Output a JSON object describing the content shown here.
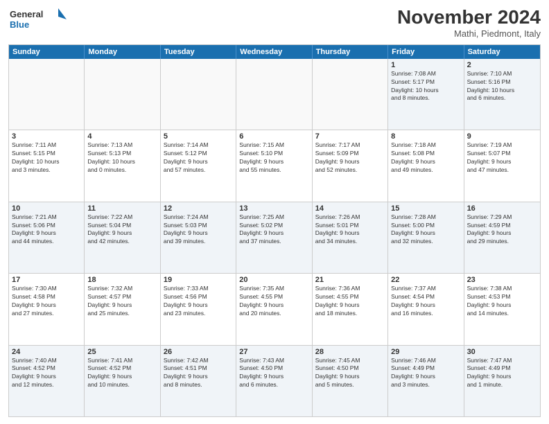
{
  "logo": {
    "line1": "General",
    "line2": "Blue"
  },
  "title": "November 2024",
  "subtitle": "Mathi, Piedmont, Italy",
  "days": [
    "Sunday",
    "Monday",
    "Tuesday",
    "Wednesday",
    "Thursday",
    "Friday",
    "Saturday"
  ],
  "weeks": [
    [
      {
        "day": "",
        "info": ""
      },
      {
        "day": "",
        "info": ""
      },
      {
        "day": "",
        "info": ""
      },
      {
        "day": "",
        "info": ""
      },
      {
        "day": "",
        "info": ""
      },
      {
        "day": "1",
        "info": "Sunrise: 7:08 AM\nSunset: 5:17 PM\nDaylight: 10 hours\nand 8 minutes."
      },
      {
        "day": "2",
        "info": "Sunrise: 7:10 AM\nSunset: 5:16 PM\nDaylight: 10 hours\nand 6 minutes."
      }
    ],
    [
      {
        "day": "3",
        "info": "Sunrise: 7:11 AM\nSunset: 5:15 PM\nDaylight: 10 hours\nand 3 minutes."
      },
      {
        "day": "4",
        "info": "Sunrise: 7:13 AM\nSunset: 5:13 PM\nDaylight: 10 hours\nand 0 minutes."
      },
      {
        "day": "5",
        "info": "Sunrise: 7:14 AM\nSunset: 5:12 PM\nDaylight: 9 hours\nand 57 minutes."
      },
      {
        "day": "6",
        "info": "Sunrise: 7:15 AM\nSunset: 5:10 PM\nDaylight: 9 hours\nand 55 minutes."
      },
      {
        "day": "7",
        "info": "Sunrise: 7:17 AM\nSunset: 5:09 PM\nDaylight: 9 hours\nand 52 minutes."
      },
      {
        "day": "8",
        "info": "Sunrise: 7:18 AM\nSunset: 5:08 PM\nDaylight: 9 hours\nand 49 minutes."
      },
      {
        "day": "9",
        "info": "Sunrise: 7:19 AM\nSunset: 5:07 PM\nDaylight: 9 hours\nand 47 minutes."
      }
    ],
    [
      {
        "day": "10",
        "info": "Sunrise: 7:21 AM\nSunset: 5:06 PM\nDaylight: 9 hours\nand 44 minutes."
      },
      {
        "day": "11",
        "info": "Sunrise: 7:22 AM\nSunset: 5:04 PM\nDaylight: 9 hours\nand 42 minutes."
      },
      {
        "day": "12",
        "info": "Sunrise: 7:24 AM\nSunset: 5:03 PM\nDaylight: 9 hours\nand 39 minutes."
      },
      {
        "day": "13",
        "info": "Sunrise: 7:25 AM\nSunset: 5:02 PM\nDaylight: 9 hours\nand 37 minutes."
      },
      {
        "day": "14",
        "info": "Sunrise: 7:26 AM\nSunset: 5:01 PM\nDaylight: 9 hours\nand 34 minutes."
      },
      {
        "day": "15",
        "info": "Sunrise: 7:28 AM\nSunset: 5:00 PM\nDaylight: 9 hours\nand 32 minutes."
      },
      {
        "day": "16",
        "info": "Sunrise: 7:29 AM\nSunset: 4:59 PM\nDaylight: 9 hours\nand 29 minutes."
      }
    ],
    [
      {
        "day": "17",
        "info": "Sunrise: 7:30 AM\nSunset: 4:58 PM\nDaylight: 9 hours\nand 27 minutes."
      },
      {
        "day": "18",
        "info": "Sunrise: 7:32 AM\nSunset: 4:57 PM\nDaylight: 9 hours\nand 25 minutes."
      },
      {
        "day": "19",
        "info": "Sunrise: 7:33 AM\nSunset: 4:56 PM\nDaylight: 9 hours\nand 23 minutes."
      },
      {
        "day": "20",
        "info": "Sunrise: 7:35 AM\nSunset: 4:55 PM\nDaylight: 9 hours\nand 20 minutes."
      },
      {
        "day": "21",
        "info": "Sunrise: 7:36 AM\nSunset: 4:55 PM\nDaylight: 9 hours\nand 18 minutes."
      },
      {
        "day": "22",
        "info": "Sunrise: 7:37 AM\nSunset: 4:54 PM\nDaylight: 9 hours\nand 16 minutes."
      },
      {
        "day": "23",
        "info": "Sunrise: 7:38 AM\nSunset: 4:53 PM\nDaylight: 9 hours\nand 14 minutes."
      }
    ],
    [
      {
        "day": "24",
        "info": "Sunrise: 7:40 AM\nSunset: 4:52 PM\nDaylight: 9 hours\nand 12 minutes."
      },
      {
        "day": "25",
        "info": "Sunrise: 7:41 AM\nSunset: 4:52 PM\nDaylight: 9 hours\nand 10 minutes."
      },
      {
        "day": "26",
        "info": "Sunrise: 7:42 AM\nSunset: 4:51 PM\nDaylight: 9 hours\nand 8 minutes."
      },
      {
        "day": "27",
        "info": "Sunrise: 7:43 AM\nSunset: 4:50 PM\nDaylight: 9 hours\nand 6 minutes."
      },
      {
        "day": "28",
        "info": "Sunrise: 7:45 AM\nSunset: 4:50 PM\nDaylight: 9 hours\nand 5 minutes."
      },
      {
        "day": "29",
        "info": "Sunrise: 7:46 AM\nSunset: 4:49 PM\nDaylight: 9 hours\nand 3 minutes."
      },
      {
        "day": "30",
        "info": "Sunrise: 7:47 AM\nSunset: 4:49 PM\nDaylight: 9 hours\nand 1 minute."
      }
    ]
  ]
}
